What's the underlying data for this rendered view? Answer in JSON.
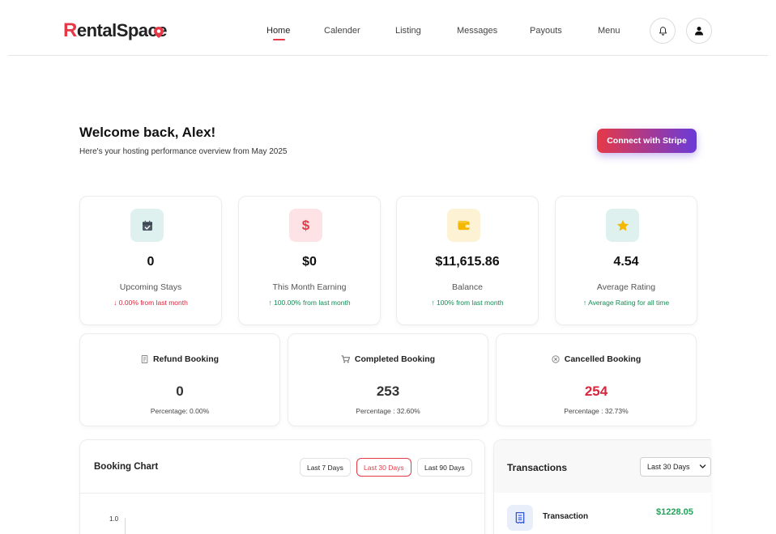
{
  "brand": {
    "first_letter": "R",
    "rest": "entalSpace",
    "accent_color": "#e53948",
    "gradient_end": "#6a3bd8"
  },
  "nav": {
    "items": [
      {
        "label": "Home",
        "active": true
      },
      {
        "label": "Calender"
      },
      {
        "label": "Listing"
      },
      {
        "label": "Messages"
      },
      {
        "label": "Payouts"
      },
      {
        "label": "Menu"
      }
    ],
    "icons": [
      "bell-icon",
      "user-icon"
    ]
  },
  "welcome": {
    "title": "Welcome back, Alex!",
    "subtitle": "Here's your hosting performance overview from May 2025",
    "stripe_button": "Connect with Stripe"
  },
  "stats": [
    {
      "icon": "calendar-check-icon",
      "value": "0",
      "label": "Upcoming Stays",
      "trend": "0.00% from last month",
      "direction": "down"
    },
    {
      "icon": "dollar-icon",
      "value": "$0",
      "label": "This Month Earning",
      "trend": "100.00% from last month",
      "direction": "up"
    },
    {
      "icon": "wallet-icon",
      "value": "$11,615.86",
      "label": "Balance",
      "trend": "100% from last month",
      "direction": "up"
    },
    {
      "icon": "star-icon",
      "value": "4.54",
      "label": "Average Rating",
      "trend": "Average Rating for all time",
      "direction": "up"
    }
  ],
  "bookings": [
    {
      "icon": "receipt-icon",
      "title": "Refund Booking",
      "value": "0",
      "percentage": "Percentage: 0.00%"
    },
    {
      "icon": "cart-icon",
      "title": "Completed Booking",
      "value": "253",
      "percentage": "Percentage : 32.60%"
    },
    {
      "icon": "cancel-circle-icon",
      "title": "Cancelled Booking",
      "value": "254",
      "percentage": "Percentage : 32.73%"
    }
  ],
  "booking_chart": {
    "title": "Booking Chart",
    "ranges": [
      "Last 7 Days",
      "Last 30 Days",
      "Last 90 Days"
    ],
    "active_range": "Last 30 Days",
    "y_tick_top": "1.0"
  },
  "transactions": {
    "title": "Transactions",
    "select_value": "Last 30 Days",
    "items": [
      {
        "name": "Transaction",
        "amount": "$1228.05"
      }
    ]
  }
}
